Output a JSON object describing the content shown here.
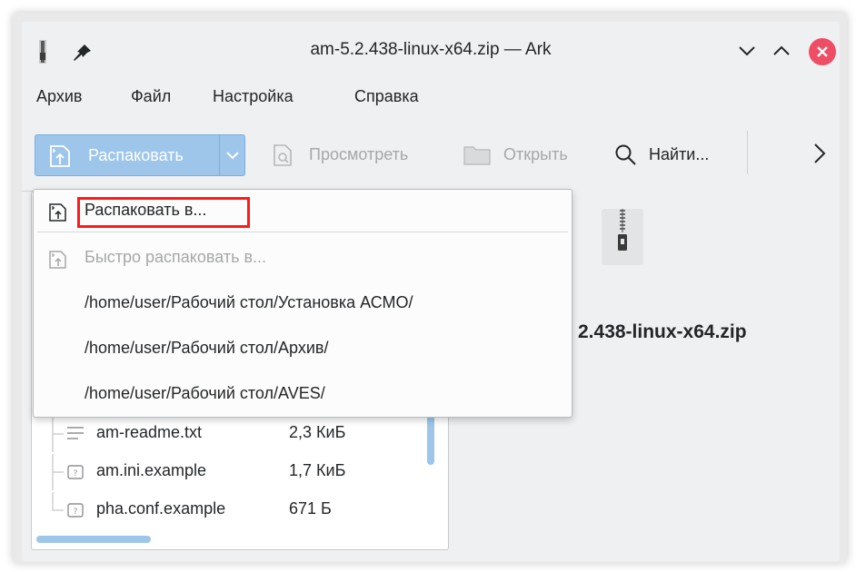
{
  "window": {
    "title": "am-5.2.438-linux-x64.zip — Ark"
  },
  "menubar": {
    "items": [
      "Архив",
      "Файл",
      "Настройка",
      "Справка"
    ]
  },
  "toolbar": {
    "extract_label": "Распаковать",
    "preview_label": "Просмотреть",
    "open_label": "Открыть",
    "find_label": "Найти..."
  },
  "extract_menu": {
    "extract_to": "Распаковать в...",
    "quick_extract_to": "Быстро распаковать в...",
    "recent_paths": [
      "/home/user/Рабочий стол/Установка АСМО/",
      "/home/user/Рабочий стол/Архив/",
      "/home/user/Рабочий стол/AVES/"
    ]
  },
  "files": [
    {
      "name": "am-readme.txt",
      "size": "2,3 КиБ",
      "icon": "text-file-icon"
    },
    {
      "name": "am.ini.example",
      "size": "1,7 КиБ",
      "icon": "unknown-file-icon"
    },
    {
      "name": "pha.conf.example",
      "size": "671 Б",
      "icon": "unknown-file-icon"
    }
  ],
  "info_panel": {
    "archive_name_visible": "2.438-linux-x64.zip"
  },
  "colors": {
    "accent": "#9ec6ea",
    "close_button": "#ef4d64",
    "highlight": "#ff1a1a"
  }
}
